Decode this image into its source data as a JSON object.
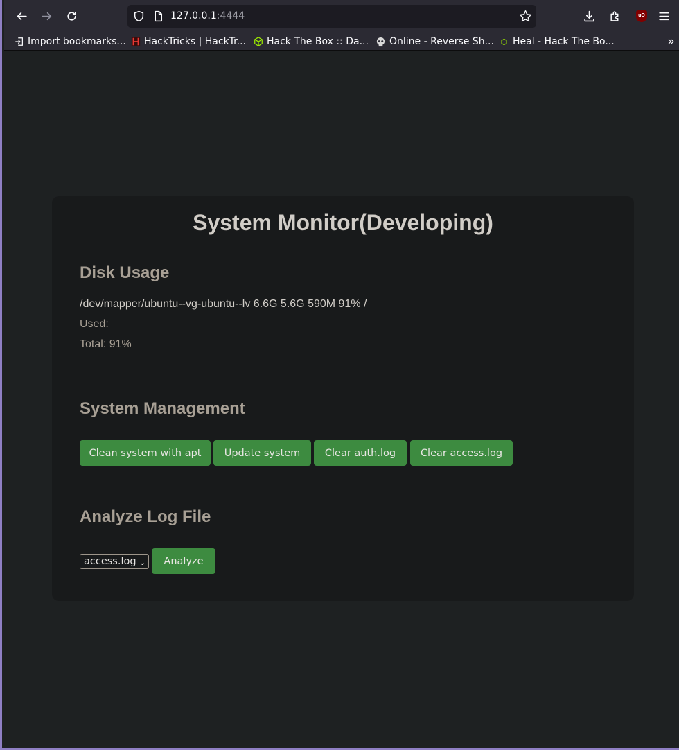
{
  "browser": {
    "url_host": "127.0.0.1",
    "url_port": ":4444",
    "bookmarks": [
      {
        "label": "Import bookmarks...",
        "icon": "import-icon"
      },
      {
        "label": "HackTricks | HackTr...",
        "icon": "hacktricks-icon"
      },
      {
        "label": "Hack The Box :: Da...",
        "icon": "htb-cube-icon"
      },
      {
        "label": "Online - Reverse Sh...",
        "icon": "skull-icon"
      },
      {
        "label": "Heal - Hack The Bo...",
        "icon": "htb-small-icon"
      }
    ],
    "ublock_label": "uO"
  },
  "page": {
    "title": "System Monitor(Developing)",
    "disk": {
      "heading": "Disk Usage",
      "line": "/dev/mapper/ubuntu--vg-ubuntu--lv 6.6G 5.6G 590M 91% /",
      "used": "Used:",
      "total": "Total: 91%"
    },
    "management": {
      "heading": "System Management",
      "buttons": [
        "Clean system with apt",
        "Update system",
        "Clear auth.log",
        "Clear access.log"
      ]
    },
    "analyze": {
      "heading": "Analyze Log File",
      "selected": "access.log",
      "button": "Analyze"
    }
  },
  "colors": {
    "accent_green": "#3d8b40",
    "card_bg": "#181a1b",
    "page_bg": "#1e2122",
    "heading": "#a8a095"
  }
}
